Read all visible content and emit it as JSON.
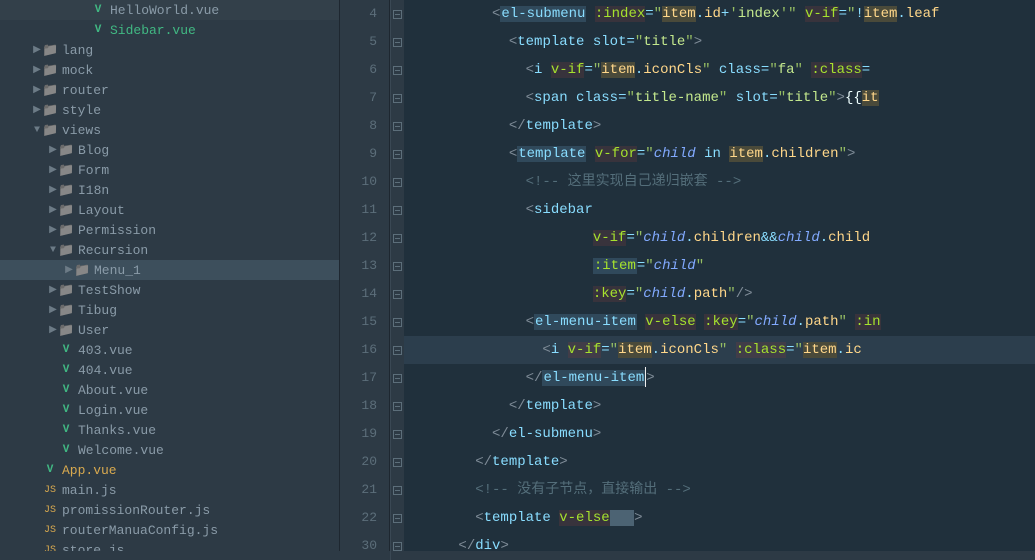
{
  "tree": [
    {
      "indent": 5,
      "arrow": "",
      "icon": "vue",
      "label": "HelloWorld.vue"
    },
    {
      "indent": 5,
      "arrow": "",
      "icon": "vue",
      "label": "Sidebar.vue",
      "style": "color:#41b883"
    },
    {
      "indent": 2,
      "arrow": "▶",
      "icon": "folder",
      "label": "lang"
    },
    {
      "indent": 2,
      "arrow": "▶",
      "icon": "folder",
      "label": "mock"
    },
    {
      "indent": 2,
      "arrow": "▶",
      "icon": "folder",
      "label": "router"
    },
    {
      "indent": 2,
      "arrow": "▶",
      "icon": "folder",
      "label": "style"
    },
    {
      "indent": 2,
      "arrow": "▼",
      "icon": "folder",
      "label": "views"
    },
    {
      "indent": 3,
      "arrow": "▶",
      "icon": "folder",
      "label": "Blog"
    },
    {
      "indent": 3,
      "arrow": "▶",
      "icon": "folder",
      "label": "Form"
    },
    {
      "indent": 3,
      "arrow": "▶",
      "icon": "folder",
      "label": "I18n"
    },
    {
      "indent": 3,
      "arrow": "▶",
      "icon": "folder",
      "label": "Layout"
    },
    {
      "indent": 3,
      "arrow": "▶",
      "icon": "folder",
      "label": "Permission"
    },
    {
      "indent": 3,
      "arrow": "▼",
      "icon": "folder",
      "label": "Recursion"
    },
    {
      "indent": 4,
      "arrow": "▶",
      "icon": "folder",
      "label": "Menu_1",
      "selected": true
    },
    {
      "indent": 3,
      "arrow": "▶",
      "icon": "folder",
      "label": "TestShow"
    },
    {
      "indent": 3,
      "arrow": "▶",
      "icon": "folder",
      "label": "Tibug"
    },
    {
      "indent": 3,
      "arrow": "▶",
      "icon": "folder",
      "label": "User"
    },
    {
      "indent": 3,
      "arrow": "",
      "icon": "vue",
      "label": "403.vue"
    },
    {
      "indent": 3,
      "arrow": "",
      "icon": "vue",
      "label": "404.vue"
    },
    {
      "indent": 3,
      "arrow": "",
      "icon": "vue",
      "label": "About.vue"
    },
    {
      "indent": 3,
      "arrow": "",
      "icon": "vue",
      "label": "Login.vue"
    },
    {
      "indent": 3,
      "arrow": "",
      "icon": "vue",
      "label": "Thanks.vue"
    },
    {
      "indent": 3,
      "arrow": "",
      "icon": "vue",
      "label": "Welcome.vue"
    },
    {
      "indent": 2,
      "arrow": "",
      "icon": "vue",
      "label": "App.vue",
      "style": "color:#d8a94f"
    },
    {
      "indent": 2,
      "arrow": "",
      "icon": "js",
      "label": "main.js"
    },
    {
      "indent": 2,
      "arrow": "",
      "icon": "js",
      "label": "promissionRouter.js"
    },
    {
      "indent": 2,
      "arrow": "",
      "icon": "js",
      "label": "routerManuaConfig.js"
    },
    {
      "indent": 2,
      "arrow": "",
      "icon": "js",
      "label": "store.js"
    }
  ],
  "lineNumbers": [
    "4",
    "5",
    "6",
    "7",
    "8",
    "9",
    "10",
    "11",
    "12",
    "13",
    "14",
    "15",
    "16",
    "17",
    "18",
    "19",
    "20",
    "21",
    "22",
    "30"
  ],
  "code": {
    "comment1": "这里实现自己递归嵌套",
    "comment2": "没有子节点，直接输出",
    "items": {
      "item": "item",
      "child": "child",
      "id": "id",
      "index": "index",
      "iconCls": "iconCls",
      "children": "children",
      "path": "path",
      "leaf": "leaf"
    },
    "tags": {
      "el_submenu": "el-submenu",
      "template": "template",
      "i": "i",
      "span": "span",
      "sidebar": "sidebar",
      "el_menu_item": "el-menu-item",
      "div": "div"
    },
    "attrs": {
      "index": ":index",
      "v_if": "v-if",
      "slot": "slot",
      "class": "class",
      "cclass": ":class",
      "v_for": "v-for",
      "v_else": "v-else",
      "item": ":item",
      "key": ":key",
      "in": "in"
    },
    "strings": {
      "title": "title",
      "fa": "fa",
      "title_name": "title-name"
    },
    "interp": "{{"
  }
}
